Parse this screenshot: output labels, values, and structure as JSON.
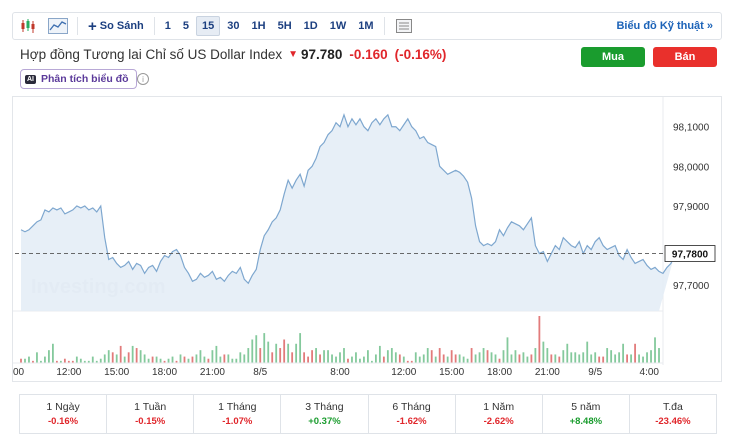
{
  "toolbar": {
    "compare_label": "So Sánh",
    "intervals": [
      "1",
      "5",
      "15",
      "30",
      "1H",
      "5H",
      "1D",
      "1W",
      "1M"
    ],
    "active_interval": "15",
    "advanced_chart_label": "Biểu đồ Kỹ thuật »"
  },
  "header": {
    "title": "Hợp đồng Tương lai Chỉ số US Dollar Index",
    "price": "97.780",
    "change": "-0.160",
    "change_pct": "(-0.16%)",
    "buy_label": "Mua",
    "sell_label": "Bán",
    "analysis_label": "Phân tích biểu đồ",
    "ai_badge": "AI",
    "info_glyph": "i"
  },
  "colors": {
    "line": "#7ea7cf",
    "area": "#e4edf6",
    "volume_up": "#84c99c",
    "volume_down": "#e27b7b",
    "negative": "#e0262b",
    "positive": "#1a9c2e"
  },
  "chart_data": {
    "type": "area",
    "watermark": "Investing.com",
    "y_ticks": [
      "98,1000",
      "98,0000",
      "97,9000",
      "97,8000",
      "97,7000"
    ],
    "y_tick_values": [
      98.1,
      98.0,
      97.9,
      97.8,
      97.7
    ],
    "ylim": [
      97.635,
      98.175
    ],
    "last_price_label": "97,7800",
    "last_price": 97.78,
    "x_ticks": [
      "00",
      "12:00",
      "15:00",
      "18:00",
      "21:00",
      "8/5",
      "8:00",
      "12:00",
      "15:00",
      "18:00",
      "21:00",
      "9/5",
      "4:00"
    ],
    "x_tick_positions": [
      0,
      12,
      24,
      36,
      48,
      60,
      80,
      96,
      108,
      120,
      132,
      144,
      160
    ],
    "x_count": 161,
    "values": [
      97.84,
      97.835,
      97.84,
      97.85,
      97.86,
      97.865,
      97.89,
      97.885,
      97.895,
      97.89,
      97.895,
      97.88,
      97.885,
      97.89,
      97.9,
      97.895,
      97.9,
      97.89,
      97.895,
      97.885,
      97.9,
      97.82,
      97.765,
      97.77,
      97.755,
      97.745,
      97.75,
      97.76,
      97.74,
      97.755,
      97.75,
      97.73,
      97.745,
      97.75,
      97.735,
      97.76,
      97.775,
      97.77,
      97.785,
      97.79,
      97.775,
      97.745,
      97.73,
      97.71,
      97.715,
      97.73,
      97.72,
      97.725,
      97.735,
      97.715,
      97.72,
      97.71,
      97.725,
      97.735,
      97.73,
      97.745,
      97.715,
      97.705,
      97.725,
      97.74,
      97.79,
      97.825,
      97.84,
      97.86,
      97.87,
      97.89,
      97.93,
      97.965,
      97.945,
      97.965,
      97.98,
      97.95,
      97.99,
      98.0,
      98.02,
      98.05,
      98.06,
      98.08,
      98.09,
      98.11,
      98.1,
      98.13,
      98.1,
      98.12,
      98.105,
      98.12,
      98.1,
      98.09,
      98.11,
      98.12,
      98.105,
      98.12,
      98.13,
      98.1,
      98.1,
      98.09,
      98.105,
      98.12,
      98.1,
      98.09,
      98.07,
      98.075,
      98.06,
      98.055,
      98.05,
      98.0,
      97.99,
      97.98,
      97.985,
      97.99,
      97.985,
      97.975,
      97.96,
      97.92,
      97.85,
      97.81,
      97.8,
      97.805,
      97.8,
      97.81,
      97.84,
      97.825,
      97.845,
      97.86,
      97.855,
      97.85,
      97.84,
      97.855,
      97.87,
      97.8,
      97.78,
      97.785,
      97.76,
      97.78,
      97.8,
      97.79,
      97.82,
      97.81,
      97.8,
      97.795,
      97.81,
      97.78,
      97.8,
      97.79,
      97.81,
      97.82,
      97.8,
      97.79,
      97.795,
      97.8,
      97.775,
      97.765,
      97.79,
      97.77,
      97.755,
      97.76,
      97.765,
      97.75,
      97.74,
      97.745,
      97.735,
      97.73,
      97.745,
      97.755,
      97.78
    ],
    "volume": [
      2,
      2,
      3,
      1,
      5,
      1,
      3,
      6,
      9,
      1,
      1,
      2,
      1,
      1,
      3,
      2,
      1,
      1,
      3,
      1,
      2,
      4,
      6,
      5,
      4,
      8,
      3,
      5,
      8,
      7,
      6,
      4,
      2,
      3,
      3,
      2,
      1,
      2,
      3,
      1,
      4,
      3,
      2,
      3,
      4,
      6,
      3,
      2,
      6,
      8,
      3,
      4,
      4,
      2,
      2,
      5,
      4,
      7,
      11,
      13,
      7,
      14,
      10,
      5,
      9,
      7,
      11,
      9,
      5,
      9,
      14,
      5,
      3,
      6,
      7,
      4,
      6,
      6,
      4,
      3,
      5,
      7,
      2,
      3,
      5,
      2,
      3,
      6,
      1,
      4,
      8,
      3,
      6,
      7,
      5,
      4,
      3,
      1,
      1,
      5,
      3,
      4,
      7,
      6,
      3,
      7,
      4,
      3,
      6,
      4,
      4,
      3,
      2,
      7,
      4,
      5,
      7,
      6,
      5,
      4,
      2,
      6,
      12,
      4,
      6,
      4,
      5,
      3,
      4,
      7,
      22,
      10,
      7,
      4,
      4,
      3,
      6,
      9,
      5,
      5,
      4,
      5,
      10,
      4,
      5,
      3,
      3,
      7,
      6,
      4,
      5,
      9,
      4,
      4,
      9,
      4,
      3,
      5,
      6,
      12,
      7
    ],
    "volume_dir": [
      "d",
      "u",
      "u",
      "d",
      "u",
      "u",
      "u",
      "u",
      "u",
      "d",
      "u",
      "d",
      "d",
      "d",
      "u",
      "u",
      "u",
      "u",
      "u",
      "u",
      "u",
      "u",
      "u",
      "d",
      "u",
      "d",
      "u",
      "d",
      "u",
      "d",
      "u",
      "u",
      "u",
      "d",
      "u",
      "u",
      "d",
      "u",
      "u",
      "d",
      "u",
      "d",
      "u",
      "d",
      "u",
      "u",
      "u",
      "d",
      "u",
      "u",
      "u",
      "d",
      "u",
      "u",
      "u",
      "u",
      "u",
      "u",
      "u",
      "u",
      "d",
      "u",
      "u",
      "d",
      "u",
      "d",
      "d",
      "u",
      "d",
      "u",
      "u",
      "d",
      "d",
      "d",
      "u",
      "d",
      "u",
      "u",
      "u",
      "u",
      "u",
      "u",
      "d",
      "u",
      "u",
      "u",
      "u",
      "u",
      "u",
      "u",
      "u",
      "d",
      "u",
      "u",
      "u",
      "d",
      "u",
      "d",
      "d",
      "u",
      "u",
      "u",
      "u",
      "d",
      "u",
      "d",
      "d",
      "u",
      "d",
      "d",
      "u",
      "u",
      "u",
      "d",
      "u",
      "u",
      "u",
      "d",
      "u",
      "u",
      "d",
      "u",
      "u",
      "u",
      "u",
      "d",
      "u",
      "u",
      "d",
      "u",
      "d",
      "u",
      "u",
      "d",
      "u",
      "d",
      "u",
      "u",
      "u",
      "u",
      "u",
      "u",
      "u",
      "u",
      "u",
      "d",
      "d",
      "u",
      "u",
      "u",
      "u",
      "u",
      "d",
      "u",
      "d",
      "u",
      "u",
      "u",
      "u",
      "u",
      "u"
    ]
  },
  "periods": [
    {
      "label": "1 Ngày",
      "value": "-0.16%",
      "dir": "down"
    },
    {
      "label": "1 Tuần",
      "value": "-0.15%",
      "dir": "down"
    },
    {
      "label": "1 Tháng",
      "value": "-1.07%",
      "dir": "down"
    },
    {
      "label": "3 Tháng",
      "value": "+0.37%",
      "dir": "up"
    },
    {
      "label": "6 Tháng",
      "value": "-1.62%",
      "dir": "down"
    },
    {
      "label": "1 Năm",
      "value": "-2.62%",
      "dir": "down"
    },
    {
      "label": "5 năm",
      "value": "+8.48%",
      "dir": "up"
    },
    {
      "label": "T.đa",
      "value": "-23.46%",
      "dir": "down"
    }
  ]
}
